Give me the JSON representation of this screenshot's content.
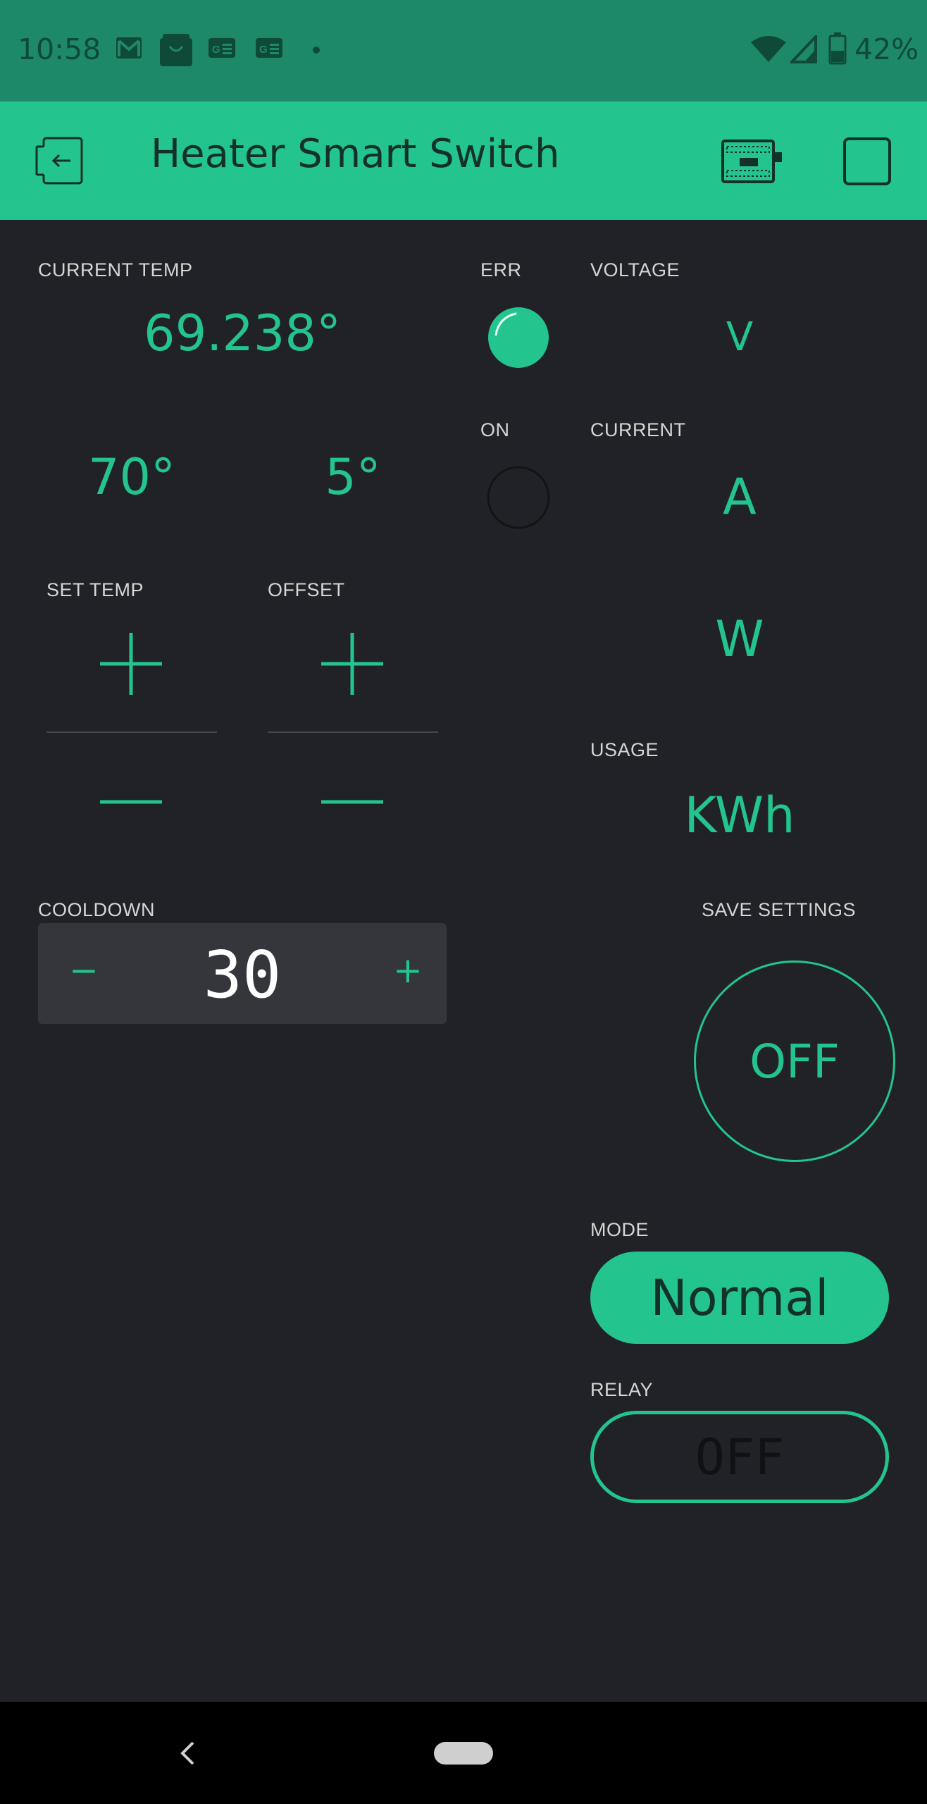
{
  "status_bar": {
    "time": "10:58",
    "battery": "42%",
    "icons": [
      "gmail-icon",
      "shopping-bag-icon",
      "google-news-icon",
      "google-news-icon",
      "wifi-icon",
      "cell-signal-icon",
      "battery-icon"
    ]
  },
  "app_bar": {
    "title": "Heater Smart Switch",
    "icons": [
      "exit-icon",
      "device-icon",
      "stop-icon"
    ]
  },
  "widgets": {
    "current_temp": {
      "label": "CURRENT TEMP",
      "value": "69.238°"
    },
    "set_temp": {
      "label": "SET TEMP",
      "value": "70°"
    },
    "offset": {
      "label": "OFFSET",
      "value": "5°"
    },
    "err": {
      "label": "ERR",
      "state": "on"
    },
    "on_led": {
      "label": "ON",
      "state": "off"
    },
    "voltage": {
      "label": "VOLTAGE",
      "value": "V"
    },
    "current": {
      "label": "CURRENT",
      "value": "A"
    },
    "power": {
      "value": "W"
    },
    "usage": {
      "label": "USAGE",
      "value": "KWh"
    },
    "cooldown": {
      "label": "COOLDOWN",
      "value": "30",
      "minus": "−",
      "plus": "+"
    },
    "save_settings": {
      "label": "SAVE SETTINGS",
      "value": "OFF"
    },
    "mode": {
      "label": "MODE",
      "value": "Normal"
    },
    "relay": {
      "label": "RELAY",
      "value": "OFF"
    }
  },
  "colors": {
    "accent": "#23c48e",
    "background": "#212227",
    "status_bar": "#1d8968"
  }
}
